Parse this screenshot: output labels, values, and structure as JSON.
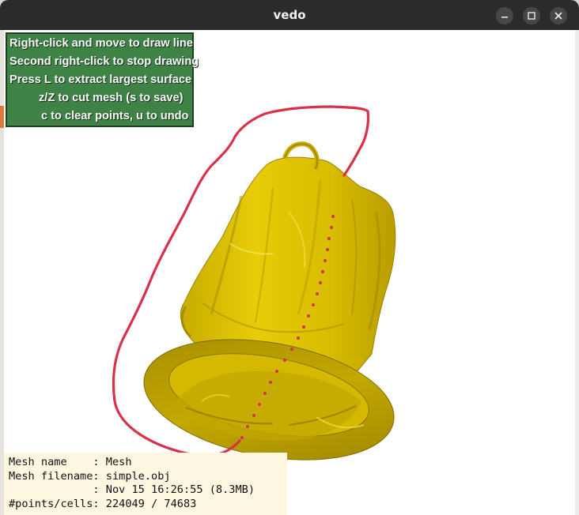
{
  "window": {
    "title": "vedo",
    "controls": {
      "minimize_icon": "minimize-icon",
      "maximize_icon": "maximize-icon",
      "close_icon": "close-icon"
    }
  },
  "help_panel": {
    "lines": [
      "Right-click and move to draw line",
      "Second right-click to stop drawing",
      "Press L to extract largest surface",
      "z/Z to cut mesh (s to save)",
      "c to clear points, u to undo"
    ]
  },
  "info_panel": {
    "lines": [
      "Mesh name    : Mesh",
      "Mesh filename: simple.obj",
      "             : Nov 15 16:26:55 (8.3MB)",
      "#points/cells: 224049 / 74683"
    ]
  },
  "colors": {
    "mesh": "#e1c400",
    "mesh_shadow": "#a89100",
    "cut_line": "#d6324a",
    "help_bg": "#3f8246",
    "info_bg": "#fdf6e0",
    "titlebar": "#2b2b2b"
  }
}
